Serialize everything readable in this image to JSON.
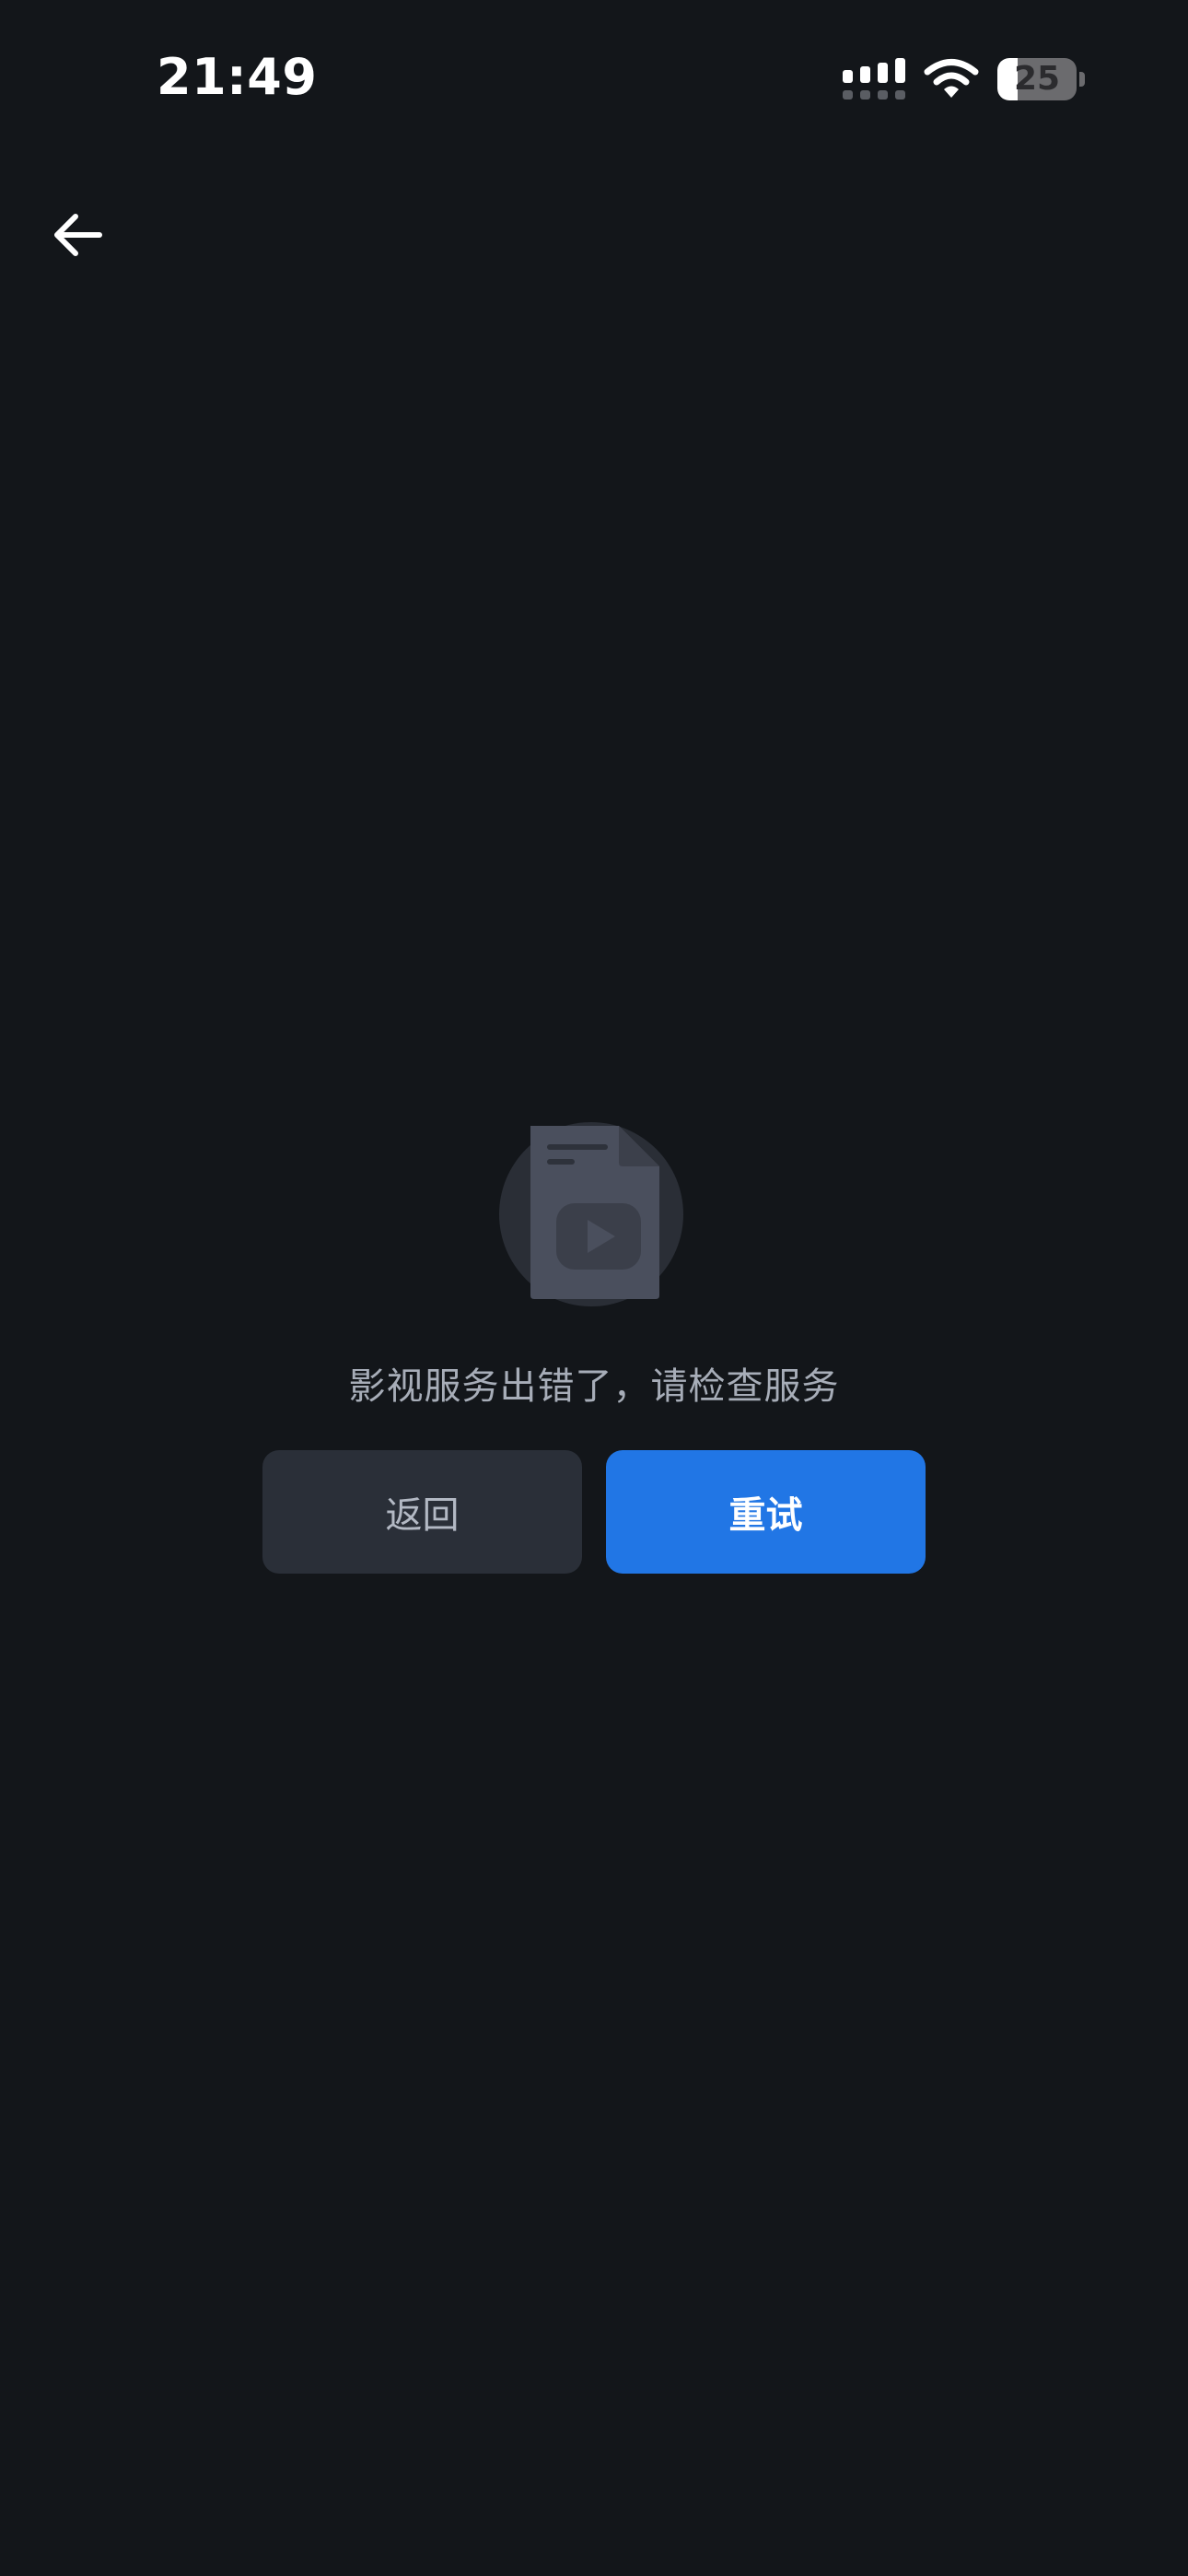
{
  "status_bar": {
    "time": "21:49",
    "battery_level": "25",
    "battery_fraction": 0.25,
    "signal_icon": "cellular-signal-icon",
    "wifi_icon": "wifi-icon",
    "battery_icon": "battery-icon"
  },
  "nav": {
    "back_icon": "arrow-left-icon"
  },
  "empty_state": {
    "illustration_icon": "video-file-icon",
    "message": "影视服务出错了，请检查服务",
    "back_label": "返回",
    "retry_label": "重试"
  },
  "colors": {
    "background": "#13161a",
    "primary_button": "#2176e5",
    "secondary_button": "#2a2f38",
    "message_text": "#a7adb8"
  }
}
